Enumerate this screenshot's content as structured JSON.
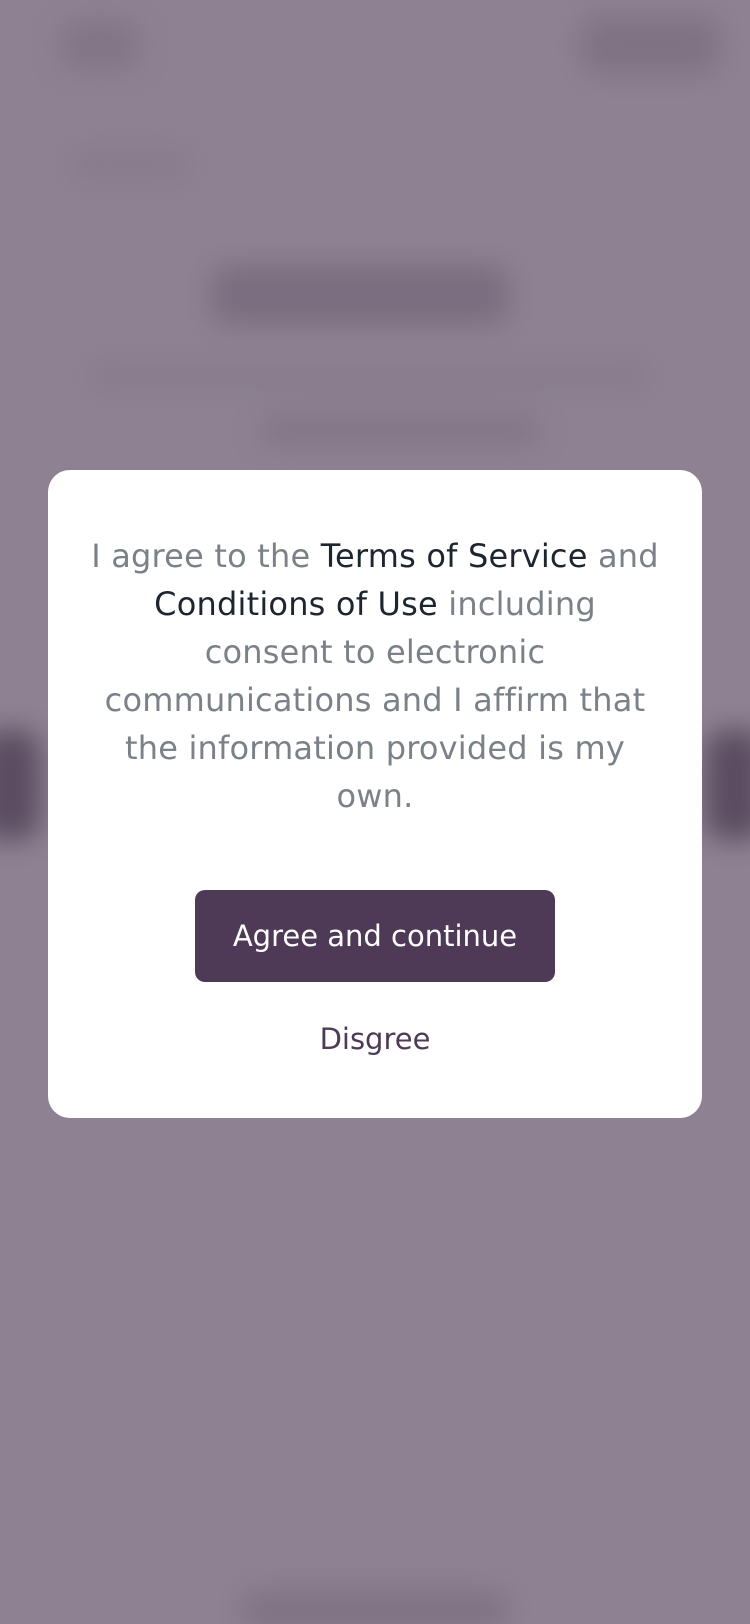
{
  "modal": {
    "text_prefix": "I agree to the ",
    "terms_link": "Terms of Service",
    "text_and": " and ",
    "conditions_link": "Conditions of Use",
    "text_suffix": " including consent to electronic communications and I affirm that the information provided is my own.",
    "agree_label": "Agree and continue",
    "disagree_label": "Disgree"
  },
  "colors": {
    "overlay_background": "#8e8292",
    "button_primary": "#4e3a56",
    "muted_text": "#7b8189",
    "link_text": "#1d2530"
  }
}
